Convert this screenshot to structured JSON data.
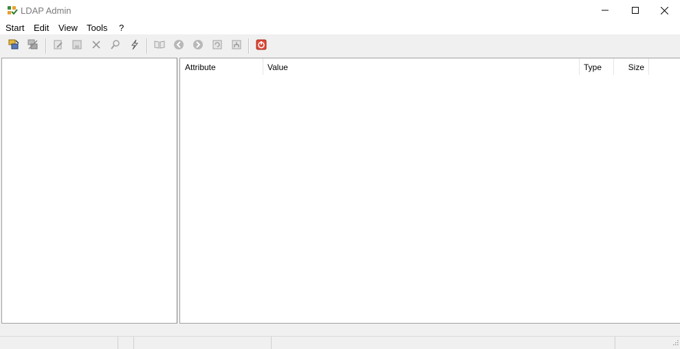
{
  "window": {
    "title": "LDAP Admin"
  },
  "menu": [
    "Start",
    "Edit",
    "View",
    "Tools",
    "?"
  ],
  "toolbar": {
    "icons": [
      "connect-icon",
      "disconnect-icon",
      "edit-entry-icon",
      "save-icon",
      "delete-icon",
      "search-icon",
      "ldap-query-icon",
      "schema-icon",
      "back-icon",
      "forward-icon",
      "refresh-icon",
      "hierarchy-icon",
      "exit-icon"
    ]
  },
  "attributes_table": {
    "columns": [
      "Attribute",
      "Value",
      "Type",
      "Size"
    ]
  },
  "colors": {
    "exit_red": "#e04a3a",
    "connect_yellow": "#e8b83a",
    "title_gray": "#7a7a7a"
  }
}
